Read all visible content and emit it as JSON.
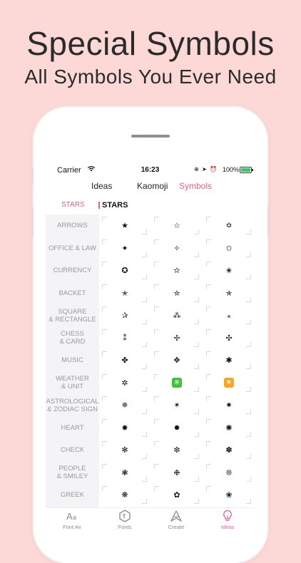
{
  "header": {
    "title": "Special Symbols",
    "subtitle": "All Symbols You Ever Need"
  },
  "status": {
    "carrier": "Carrier",
    "time": "16:23",
    "battery_pct": "100%",
    "battery_level": 1.0
  },
  "tabs": [
    {
      "label": "Ideas",
      "active": false
    },
    {
      "label": "Kaomoji",
      "active": false
    },
    {
      "label": "Symbols",
      "active": true
    }
  ],
  "subheader": {
    "left": "STARS",
    "right": "STARS"
  },
  "categories": [
    "ARROWS",
    "OFFICE & LAW",
    "CURRENCY",
    "BACKET",
    "SQUARE\n& RECTANGLE",
    "CHESS\n& CARD",
    "MUSIC",
    "WEATHER\n& UNIT",
    "ASTROLOGICAL\n& ZODIAC SIGN",
    "HEART",
    "CHECK",
    "PEOPLE\n& SMILEY",
    "GREEK"
  ],
  "symbols": [
    [
      "★",
      "☆",
      "✡"
    ],
    [
      "✦",
      "✧",
      "✩"
    ],
    [
      "✪",
      "✫",
      "✬"
    ],
    [
      "✭",
      "✮",
      "✯"
    ],
    [
      "✰",
      "⁂",
      "⁎"
    ],
    [
      "⁑",
      "✢",
      "✣"
    ],
    [
      "✤",
      "✥",
      "✱"
    ],
    [
      "✲",
      "✳",
      "✴"
    ],
    [
      "✵",
      "✶",
      "✷"
    ],
    [
      "✸",
      "✹",
      "✺"
    ],
    [
      "✻",
      "✼",
      "✽"
    ],
    [
      "❃",
      "❉",
      "❊"
    ],
    [
      "❋",
      "✿",
      "❀"
    ]
  ],
  "special_cells": {
    "7-1": "green",
    "7-2": "orange"
  },
  "bottomnav": [
    {
      "label": "Font Air",
      "icon": "font-air-icon",
      "active": false
    },
    {
      "label": "Fonts",
      "icon": "fonts-icon",
      "active": false
    },
    {
      "label": "Create",
      "icon": "create-icon",
      "active": false
    },
    {
      "label": "Ideas",
      "icon": "ideas-bulb-icon",
      "active": true
    }
  ],
  "colors": {
    "background": "#fcd9d7",
    "accent": "#e0608a",
    "sidebar": "#f4f4f6",
    "emoji_green": "#3cc13b",
    "emoji_orange": "#f6a623"
  }
}
